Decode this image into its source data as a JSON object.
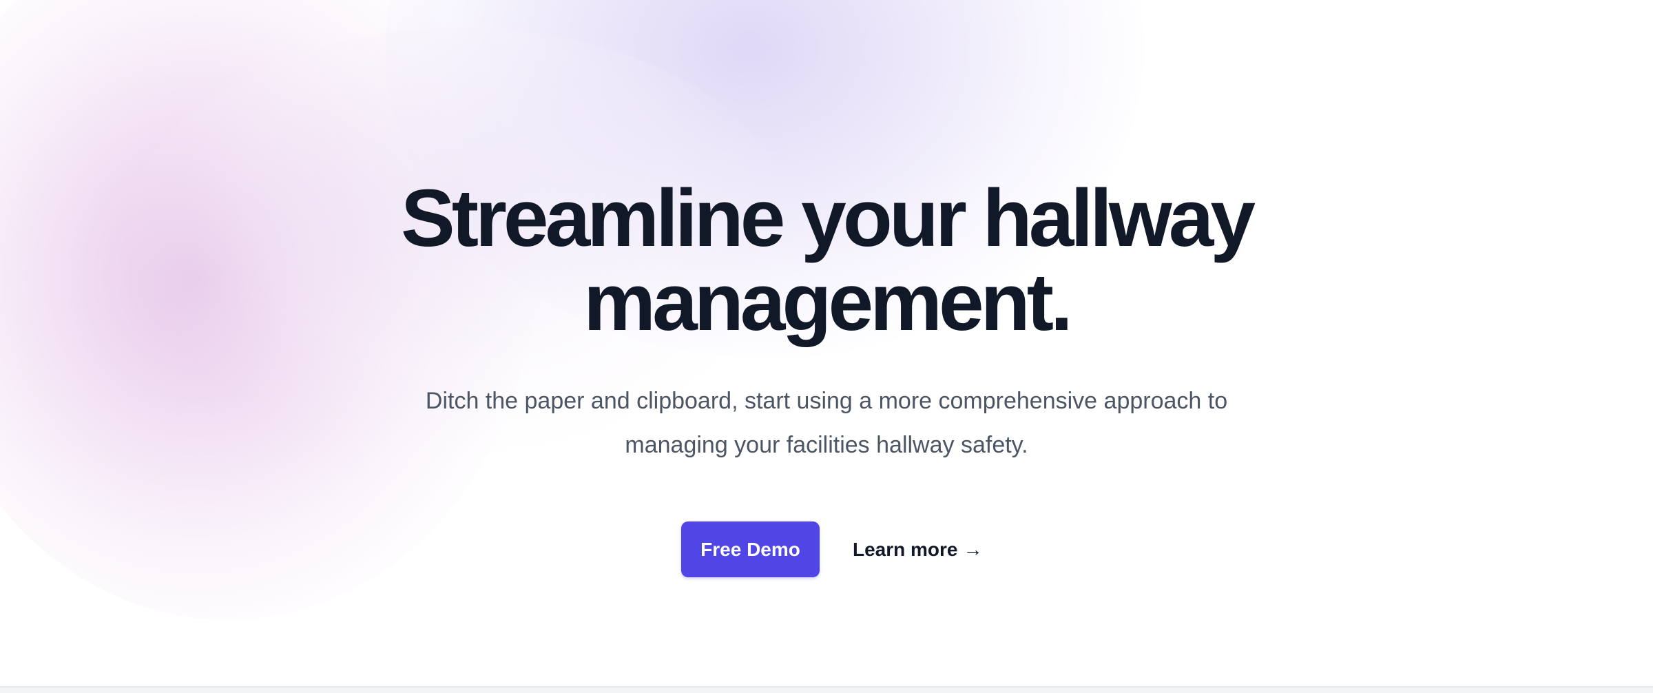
{
  "hero": {
    "headline": "Streamline your hallway management.",
    "subtitle": "Ditch the paper and clipboard, start using a more comprehensive approach to managing your facilities hallway safety.",
    "primary_button_label": "Free Demo",
    "secondary_link_label": "Learn more",
    "secondary_link_icon": "arrow-right-icon",
    "arrow_glyph": "→"
  },
  "colors": {
    "accent": "#4f46e5",
    "heading": "#111827",
    "body_text": "#4b5563",
    "background": "#ffffff",
    "gradient_pink": "#e6c6e8",
    "gradient_violet": "#ded6f6"
  }
}
